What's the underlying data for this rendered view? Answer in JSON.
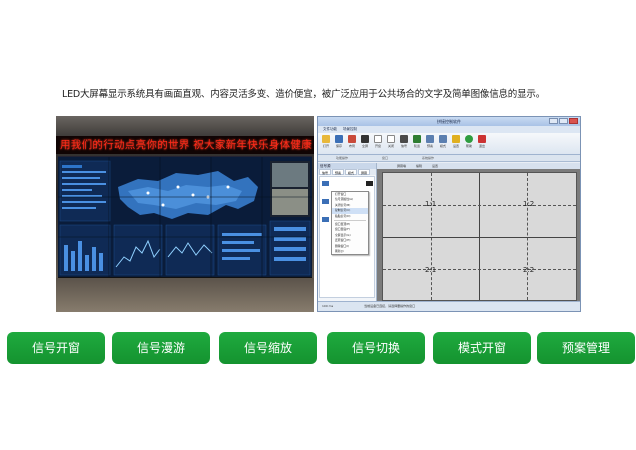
{
  "intro_text": "LED大屏幕显示系统具有画面直观、内容灵活多变、造价便宜，被广泛应用于公共场合的文字及简单图像信息的显示。",
  "photo": {
    "ticker_text": "用我们的行动点亮你的世界    祝大家新年快乐身体健康"
  },
  "app": {
    "title": "拼接控制软件",
    "menu": [
      "文件功能",
      "场景控制"
    ],
    "ribbon_buttons": [
      "打开",
      "保存",
      "布局",
      "全屏",
      "开窗",
      "关闭",
      "信号",
      "轮巡",
      "预案",
      "模式",
      "设置",
      "帮助",
      "退出"
    ],
    "ribbon_groups": [
      "功能操作",
      "窗口",
      "系统操作"
    ],
    "left_pane_title": "信号源",
    "left_tabs": [
      "信号",
      "预案",
      "模式",
      "屏幕"
    ],
    "context_menu": [
      "打开窗口",
      "信号源属性(A)",
      "关闭信号(B)",
      "复制信号(C)",
      "粘贴信号(D)",
      "窗口置顶(E)",
      "窗口置底(F)",
      "全屏显示(G)",
      "还原窗口(H)",
      "删除窗口(I)",
      "刷新(J)"
    ],
    "grid_tabs": [
      "屏幕墙",
      "编辑",
      "设置"
    ],
    "cells": [
      "1:1",
      "1:2",
      "2:1",
      "2:2"
    ],
    "status_left": "100 ms",
    "status_right": "当前设备已连接，请选择要操作的窗口"
  },
  "buttons": [
    "信号开窗",
    "信号漫游",
    "信号缩放",
    "信号切换",
    "模式开窗",
    "预案管理"
  ],
  "colors": {
    "button_green": "#18a035",
    "ticker_red": "#ff2a1a",
    "grid_gray": "#d9d9d9"
  }
}
